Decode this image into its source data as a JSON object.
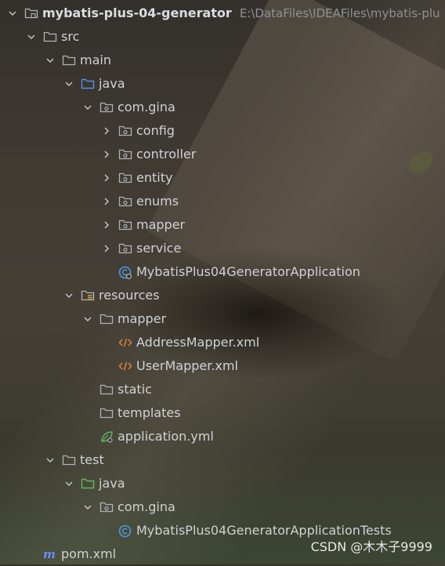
{
  "project": {
    "name": "mybatis-plus-04-generator",
    "path": "E:\\DataFiles\\IDEAFiles\\mybatis-plu"
  },
  "tree": {
    "src": "src",
    "main": "main",
    "java_main": "java",
    "com_gina_main": "com.gina",
    "packages": [
      "config",
      "controller",
      "entity",
      "enums",
      "mapper",
      "service"
    ],
    "app_class": "MybatisPlus04GeneratorApplication",
    "resources": "resources",
    "res_mapper": "mapper",
    "xml_files": [
      "AddressMapper.xml",
      "UserMapper.xml"
    ],
    "static": "static",
    "templates": "templates",
    "app_yml": "application.yml",
    "test": "test",
    "java_test": "java",
    "com_gina_test": "com.gina",
    "test_class": "MybatisPlus04GeneratorApplicationTests",
    "pom": "pom.xml"
  },
  "watermark": "CSDN @木木子9999",
  "colors": {
    "folder": "#aeb3b8",
    "source_folder": "#5a8ee6",
    "test_folder": "#5fb865",
    "class": "#4e9ae6",
    "xml": "#e0803a",
    "maven": "#6a8cff"
  }
}
